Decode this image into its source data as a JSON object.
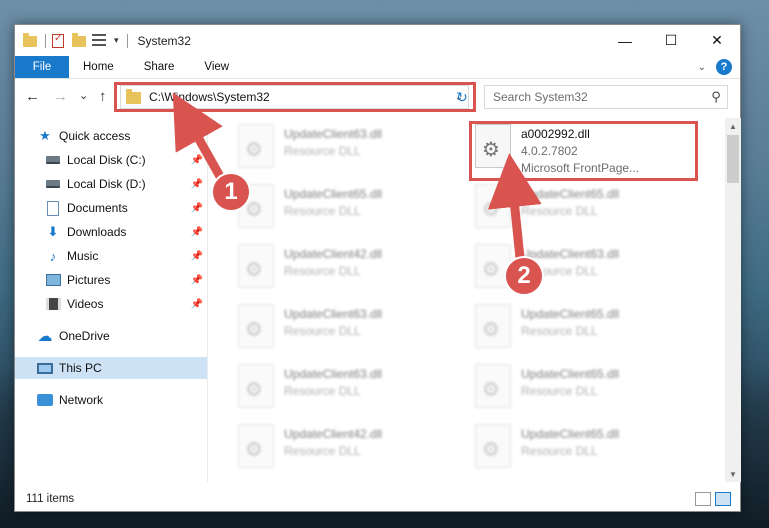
{
  "window": {
    "title": "System32",
    "minimize": "—",
    "maximize": "☐",
    "close": "✕"
  },
  "ribbon": {
    "file": "File",
    "tabs": [
      "Home",
      "Share",
      "View"
    ],
    "help": "?"
  },
  "nav": {
    "back": "←",
    "forward": "→",
    "recent": "⌄",
    "up": "↑",
    "address": "C:\\Windows\\System32",
    "refresh": "↻",
    "search_placeholder": "Search System32"
  },
  "sidebar": {
    "items": [
      {
        "label": "Quick access"
      },
      {
        "label": "Local Disk (C:)"
      },
      {
        "label": "Local Disk (D:)"
      },
      {
        "label": "Documents"
      },
      {
        "label": "Downloads"
      },
      {
        "label": "Music"
      },
      {
        "label": "Pictures"
      },
      {
        "label": "Videos"
      },
      {
        "label": "OneDrive"
      },
      {
        "label": "This PC"
      },
      {
        "label": "Network"
      }
    ]
  },
  "files": {
    "target": {
      "name": "a0002992.dll",
      "version": "4.0.2.7802",
      "description": "Microsoft FrontPage..."
    },
    "left_column": [
      {
        "name": "UpdateClient63.dll",
        "sub": "Resource DLL"
      },
      {
        "name": "UpdateClient65.dll",
        "sub": "Resource DLL"
      },
      {
        "name": "UpdateClient42.dll",
        "sub": "Resource DLL"
      },
      {
        "name": "UpdateClient63.dll",
        "sub": "Resource DLL"
      },
      {
        "name": "UpdateClient63.dll",
        "sub": "Resource DLL"
      },
      {
        "name": "UpdateClient42.dll",
        "sub": "Resource DLL"
      }
    ],
    "right_column": [
      {
        "name": "UpdateClient65.dll",
        "sub": "Resource DLL"
      },
      {
        "name": "UpdateClient63.dll",
        "sub": "Resource DLL"
      },
      {
        "name": "UpdateClient65.dll",
        "sub": "Resource DLL"
      },
      {
        "name": "UpdateClient65.dll",
        "sub": "Resource DLL"
      },
      {
        "name": "UpdateClient65.dll",
        "sub": "Resource DLL"
      }
    ]
  },
  "status": {
    "item_count": "111 items"
  },
  "annotations": {
    "step1": "1",
    "step2": "2",
    "color": "#d9534f"
  }
}
